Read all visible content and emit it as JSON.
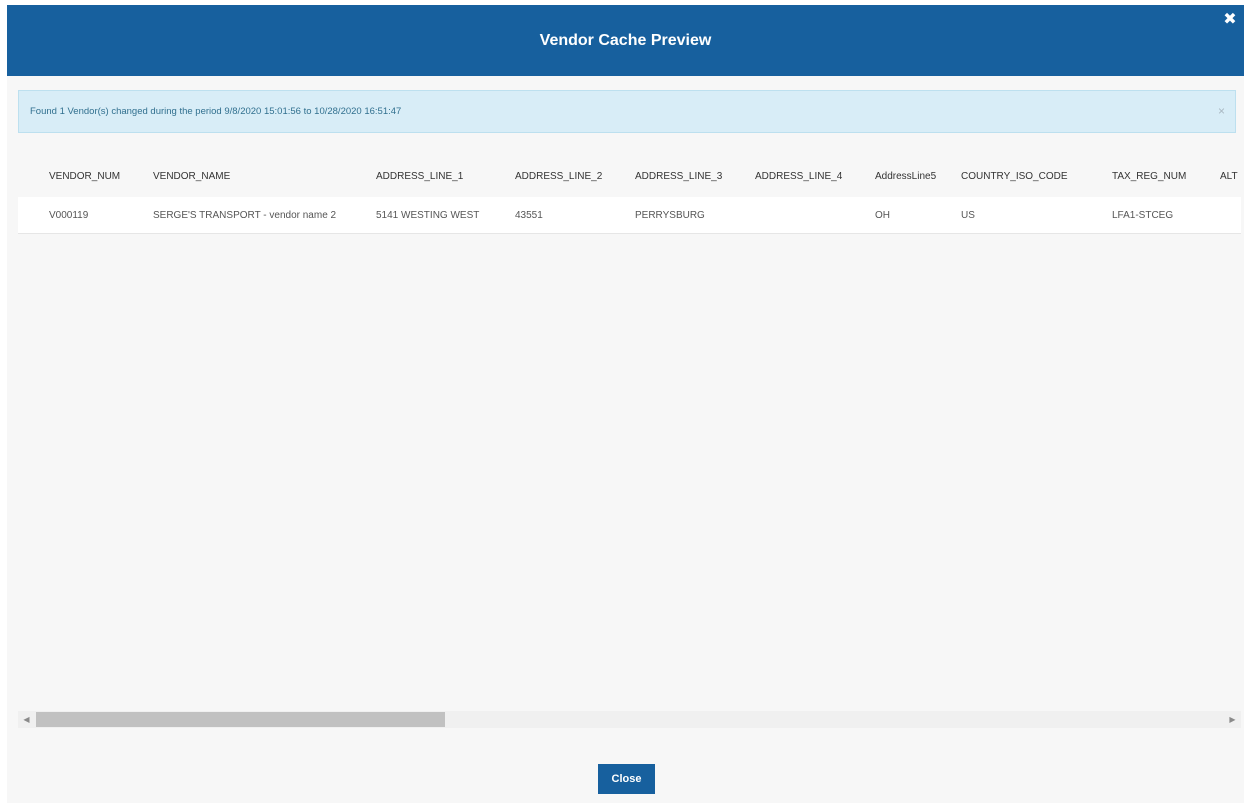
{
  "dialog": {
    "title": "Vendor Cache Preview",
    "close_icon": "close-icon"
  },
  "alert": {
    "message": "Found 1 Vendor(s) changed during the period 9/8/2020 15:01:56 to 10/28/2020 16:51:47",
    "dismiss_glyph": "×"
  },
  "grid": {
    "columns": [
      "VENDOR_NUM",
      "VENDOR_NAME",
      "ADDRESS_LINE_1",
      "ADDRESS_LINE_2",
      "ADDRESS_LINE_3",
      "ADDRESS_LINE_4",
      "AddressLine5",
      "COUNTRY_ISO_CODE",
      "TAX_REG_NUM",
      "ALT"
    ],
    "rows": [
      [
        "V000119",
        "SERGE'S TRANSPORT - vendor name 2",
        "5141 WESTING WEST",
        "43551",
        "PERRYSBURG",
        "",
        "OH",
        "US",
        "LFA1-STCEG",
        ""
      ]
    ]
  },
  "scrollbar": {
    "left_arrow": "◀",
    "right_arrow": "▶"
  },
  "footer": {
    "close_label": "Close"
  }
}
